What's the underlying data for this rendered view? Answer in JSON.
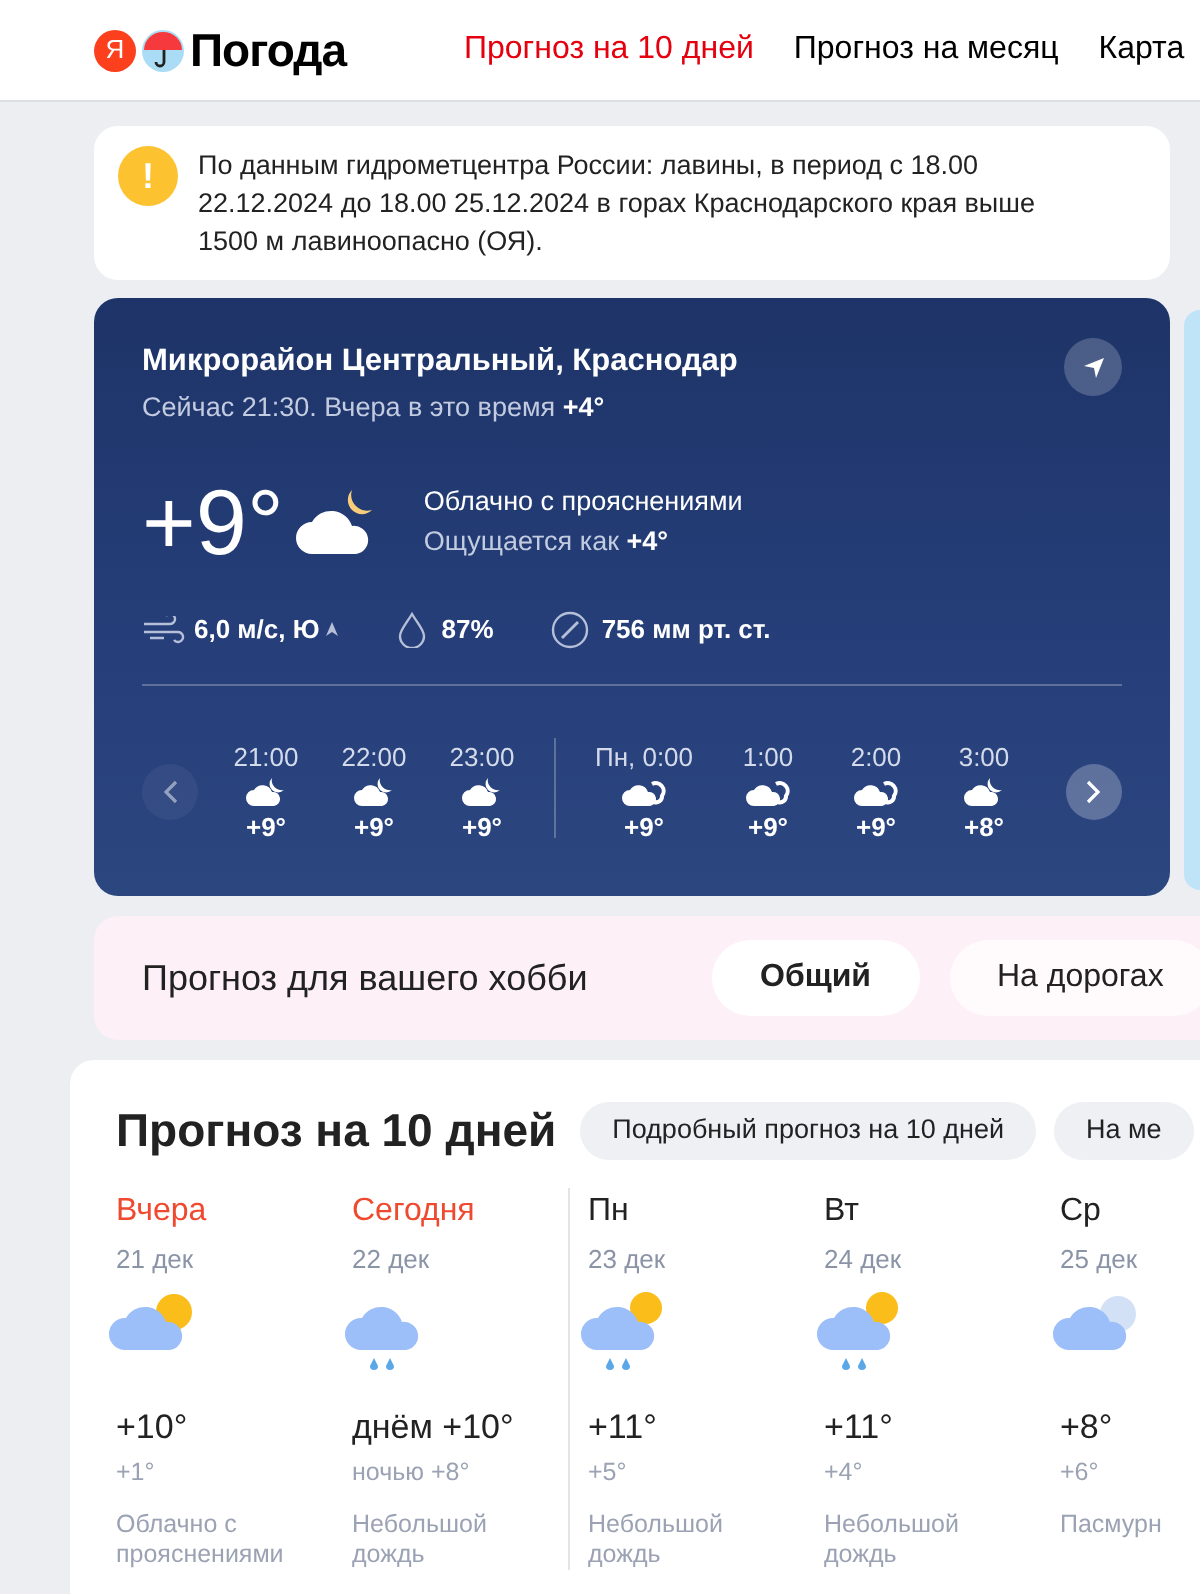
{
  "header": {
    "logo_letter": "Я",
    "logo_text": "Погода",
    "nav": [
      {
        "label": "Прогноз на 10 дней",
        "selected": true
      },
      {
        "label": "Прогноз на месяц",
        "selected": false
      },
      {
        "label": "Карта",
        "selected": false
      }
    ]
  },
  "alert": {
    "icon_text": "!",
    "text": "По данным гидрометцентра России: лавины, в период с 18.00 22.12.2024 до 18.00 25.12.2024 в горах Краснодарского края выше 1500 м лавиноопасно (ОЯ)."
  },
  "current": {
    "location": "Микрорайон Центральный, Краснодар",
    "subtitle": "Сейчас 21:30. Вчера в это время",
    "yesterday_temp": "+4°",
    "temp": "+9°",
    "condition": "Облачно с прояснениями",
    "feels_label": "Ощущается как",
    "feels_temp": "+4°",
    "wind": "6,0 м/с, Ю",
    "humidity": "87%",
    "pressure": "756 мм рт. ст.",
    "hours": [
      {
        "time": "21:00",
        "temp": "+9°",
        "kind": "moon",
        "new_day": false
      },
      {
        "time": "22:00",
        "temp": "+9°",
        "kind": "moon",
        "new_day": false
      },
      {
        "time": "23:00",
        "temp": "+9°",
        "kind": "moon",
        "new_day": false
      },
      {
        "time": "Пн, 0:00",
        "temp": "+9°",
        "kind": "cloudy",
        "new_day": true
      },
      {
        "time": "1:00",
        "temp": "+9°",
        "kind": "cloudy",
        "new_day": false
      },
      {
        "time": "2:00",
        "temp": "+9°",
        "kind": "cloudy",
        "new_day": false
      },
      {
        "time": "3:00",
        "temp": "+8°",
        "kind": "moon",
        "new_day": false
      }
    ],
    "prev_disabled": true
  },
  "hobby": {
    "title": "Прогноз для вашего хобби",
    "options": [
      {
        "label": "Общий",
        "selected": true
      },
      {
        "label": "На дорогах",
        "selected": false
      }
    ]
  },
  "forecast": {
    "title": "Прогноз на 10 дней",
    "links": [
      "Подробный прогноз на 10 дней",
      "На ме"
    ],
    "days": [
      {
        "name": "Вчера",
        "highlight": true,
        "date": "21 дек",
        "kind": "partly",
        "day_temp": "+10°",
        "night_temp": "+1°",
        "condition": "Облачно с прояснениями",
        "divider_before": false
      },
      {
        "name": "Сегодня",
        "highlight": true,
        "date": "22 дек",
        "kind": "rain",
        "day_temp": "днём +10°",
        "night_temp": "ночью +8°",
        "condition": "Небольшой дождь",
        "divider_before": false
      },
      {
        "name": "Пн",
        "highlight": false,
        "date": "23 дек",
        "kind": "showers",
        "day_temp": "+11°",
        "night_temp": "+5°",
        "condition": "Небольшой дождь",
        "divider_before": true
      },
      {
        "name": "Вт",
        "highlight": false,
        "date": "24 дек",
        "kind": "showers",
        "day_temp": "+11°",
        "night_temp": "+4°",
        "condition": "Небольшой дождь",
        "divider_before": false
      },
      {
        "name": "Ср",
        "highlight": false,
        "date": "25 дек",
        "kind": "overcast",
        "day_temp": "+8°",
        "night_temp": "+6°",
        "condition": "Пасмурн",
        "divider_before": false
      }
    ]
  }
}
